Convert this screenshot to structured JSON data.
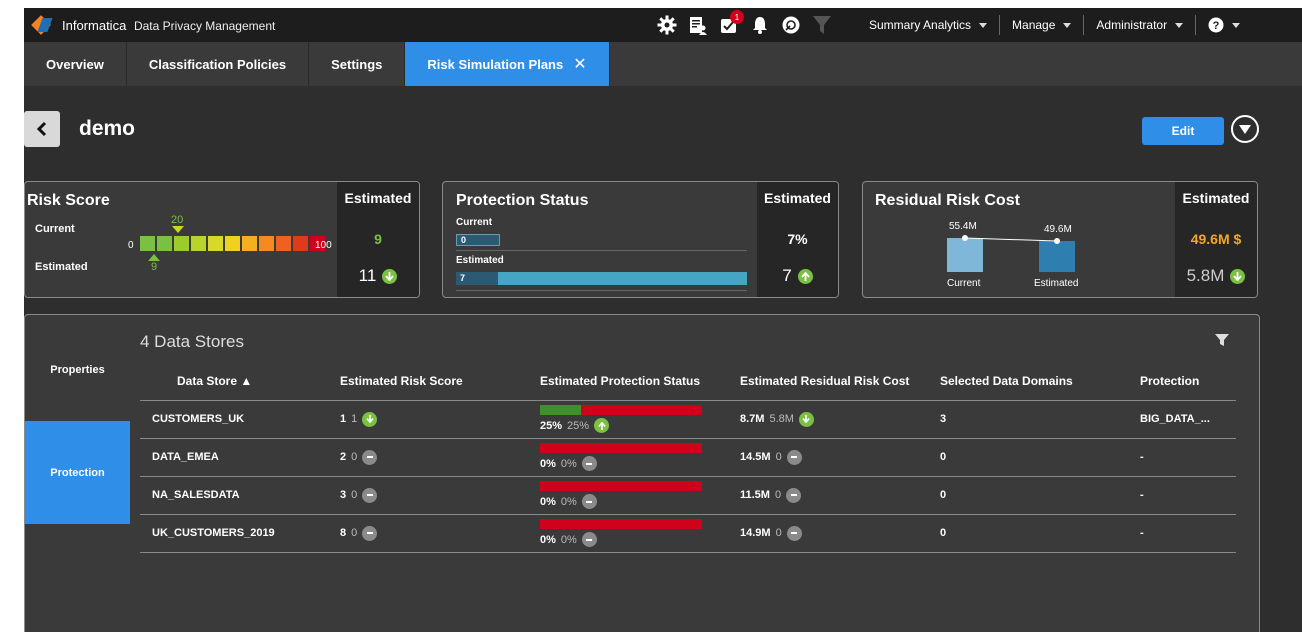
{
  "app": {
    "brand": "Informatica",
    "product": "Data Privacy Management",
    "notification_count": "1"
  },
  "top_menus": [
    "Summary Analytics",
    "Manage",
    "Administrator"
  ],
  "tabs": [
    "Overview",
    "Classification Policies",
    "Settings",
    "Risk Simulation Plans"
  ],
  "page": {
    "title": "demo",
    "edit_label": "Edit"
  },
  "risk_score": {
    "title": "Risk Score",
    "current_label": "Current",
    "estimated_label": "Estimated",
    "min": "0",
    "max": "100",
    "current_marker": "20",
    "estimated_marker": "9",
    "est_header": "Estimated",
    "est_value": "9",
    "est_change": "11"
  },
  "protection_status": {
    "title": "Protection Status",
    "current_label": "Current",
    "current_value": "0",
    "estimated_label": "Estimated",
    "estimated_value": "7",
    "est_header": "Estimated",
    "est_value": "7%",
    "est_change": "7"
  },
  "residual_cost": {
    "title": "Residual Risk Cost",
    "current_value": "55.4M",
    "estimated_value": "49.6M",
    "current_label": "Current",
    "estimated_label": "Estimated",
    "est_header": "Estimated",
    "est_value": "49.6M $",
    "est_change": "5.8M"
  },
  "table": {
    "title": "4 Data Stores",
    "side": [
      "Properties",
      "Protection"
    ],
    "columns": [
      "Data Store ▲",
      "Estimated Risk Score",
      "Estimated Protection Status",
      "Estimated Residual Risk Cost",
      "Selected Data Domains",
      "Protection"
    ],
    "rows": [
      {
        "store": "CUSTOMERS_UK",
        "risk": "1",
        "risk_change": "1",
        "prot": "25%",
        "prot_change": "25%",
        "prot_fill": 0.25,
        "cost": "8.7M",
        "cost_change": "5.8M",
        "domains": "3",
        "protection": "BIG_DATA_..."
      },
      {
        "store": "DATA_EMEA",
        "risk": "2",
        "risk_change": "0",
        "prot": "0%",
        "prot_change": "0%",
        "prot_fill": 0,
        "cost": "14.5M",
        "cost_change": "0",
        "domains": "0",
        "protection": "-"
      },
      {
        "store": "NA_SALESDATA",
        "risk": "3",
        "risk_change": "0",
        "prot": "0%",
        "prot_change": "0%",
        "prot_fill": 0,
        "cost": "11.5M",
        "cost_change": "0",
        "domains": "0",
        "protection": "-"
      },
      {
        "store": "UK_CUSTOMERS_2019",
        "risk": "8",
        "risk_change": "0",
        "prot": "0%",
        "prot_change": "0%",
        "prot_fill": 0,
        "cost": "14.9M",
        "cost_change": "0",
        "domains": "0",
        "protection": "-"
      }
    ]
  },
  "colors": {
    "accent": "#2f8ee8",
    "green": "#7ac143",
    "red": "#d0021b",
    "orange": "#f5a623"
  }
}
